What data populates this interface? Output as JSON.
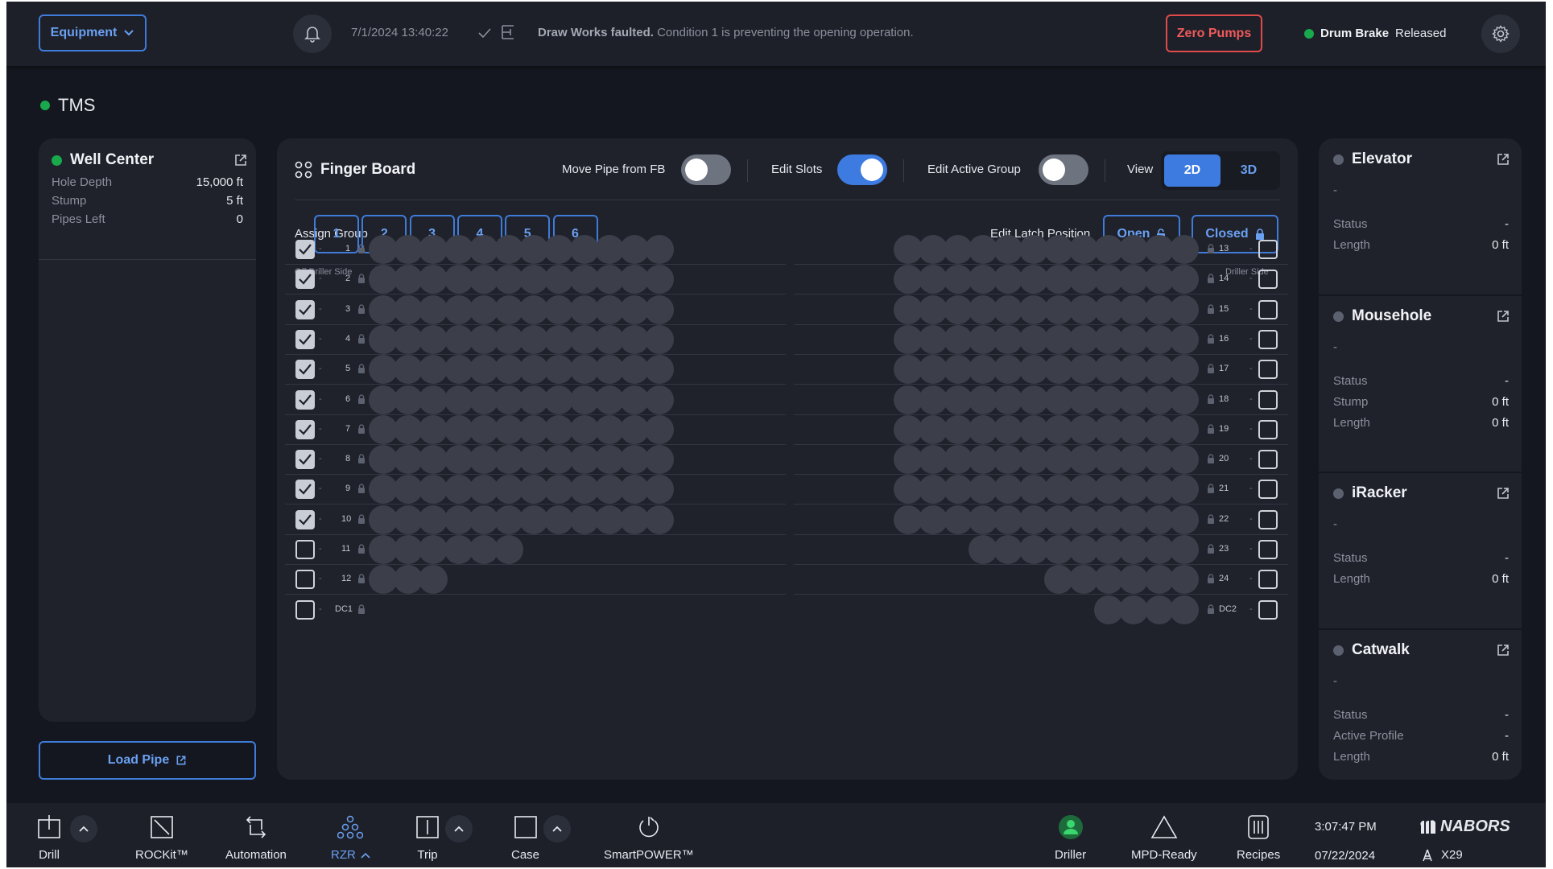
{
  "topbar": {
    "equipment_label": "Equipment",
    "datetime": "7/1/2024  13:40:22",
    "alert_bold": "Draw Works faulted.",
    "alert_text": "Condition 1 is preventing the opening operation.",
    "zero_pumps": "Zero Pumps",
    "drum_brake_label": "Drum Brake",
    "drum_brake_status": "Released"
  },
  "tms": {
    "title": "TMS"
  },
  "well_center": {
    "title": "Well Center",
    "rows": [
      {
        "label": "Hole Depth",
        "value": "15,000 ft"
      },
      {
        "label": "Stump",
        "value": "5 ft"
      },
      {
        "label": "Pipes Left",
        "value": "0"
      }
    ],
    "load_pipe": "Load Pipe"
  },
  "finger_board": {
    "title": "Finger Board",
    "move_pipe_label": "Move Pipe from FB",
    "move_pipe_on": false,
    "edit_slots_label": "Edit Slots",
    "edit_slots_on": true,
    "edit_active_group_label": "Edit Active Group",
    "edit_active_group_on": false,
    "view_label": "View",
    "view_options": [
      "2D",
      "3D"
    ],
    "view_selected": "2D",
    "assign_group_label": "Assign Group",
    "groups": [
      "1",
      "2",
      "3",
      "4",
      "5",
      "6"
    ],
    "edit_latch_label": "Edit Latch Position",
    "latch_open": "Open",
    "latch_closed": "Closed",
    "off_driller_side": "Off Driller Side",
    "driller_side": "Driller Side",
    "dash": "-",
    "left_rows": [
      {
        "label": "1",
        "checked": true,
        "pipes": 12
      },
      {
        "label": "2",
        "checked": true,
        "pipes": 12
      },
      {
        "label": "3",
        "checked": true,
        "pipes": 12
      },
      {
        "label": "4",
        "checked": true,
        "pipes": 12
      },
      {
        "label": "5",
        "checked": true,
        "pipes": 12
      },
      {
        "label": "6",
        "checked": true,
        "pipes": 12
      },
      {
        "label": "7",
        "checked": true,
        "pipes": 12
      },
      {
        "label": "8",
        "checked": true,
        "pipes": 12
      },
      {
        "label": "9",
        "checked": true,
        "pipes": 12
      },
      {
        "label": "10",
        "checked": true,
        "pipes": 12
      },
      {
        "label": "11",
        "checked": false,
        "pipes": 6
      },
      {
        "label": "12",
        "checked": false,
        "pipes": 3
      },
      {
        "label": "DC1",
        "checked": false,
        "pipes": 0
      }
    ],
    "right_rows": [
      {
        "label": "13",
        "checked": false,
        "pipes": 12
      },
      {
        "label": "14",
        "checked": false,
        "pipes": 12
      },
      {
        "label": "15",
        "checked": false,
        "pipes": 12
      },
      {
        "label": "16",
        "checked": false,
        "pipes": 12
      },
      {
        "label": "17",
        "checked": false,
        "pipes": 12
      },
      {
        "label": "18",
        "checked": false,
        "pipes": 12
      },
      {
        "label": "19",
        "checked": false,
        "pipes": 12
      },
      {
        "label": "20",
        "checked": false,
        "pipes": 12
      },
      {
        "label": "21",
        "checked": false,
        "pipes": 12
      },
      {
        "label": "22",
        "checked": false,
        "pipes": 12
      },
      {
        "label": "23",
        "checked": false,
        "pipes": 9
      },
      {
        "label": "24",
        "checked": false,
        "pipes": 6
      },
      {
        "label": "DC2",
        "checked": false,
        "pipes": 4
      }
    ]
  },
  "side_cards": [
    {
      "title": "Elevator",
      "sub": "-",
      "rows": [
        {
          "label": "Status",
          "value": "-"
        },
        {
          "label": "Length",
          "value": "0 ft"
        }
      ]
    },
    {
      "title": "Mousehole",
      "sub": "-",
      "rows": [
        {
          "label": "Status",
          "value": "-"
        },
        {
          "label": "Stump",
          "value": "0 ft"
        },
        {
          "label": "Length",
          "value": "0 ft"
        }
      ]
    },
    {
      "title": "iRacker",
      "sub": "-",
      "rows": [
        {
          "label": "Status",
          "value": "-"
        },
        {
          "label": "Length",
          "value": "0 ft"
        }
      ]
    },
    {
      "title": "Catwalk",
      "sub": "-",
      "rows": [
        {
          "label": "Status",
          "value": "-"
        },
        {
          "label": "Active Profile",
          "value": "-"
        },
        {
          "label": "Length",
          "value": "0 ft"
        }
      ]
    }
  ],
  "bottom_nav": {
    "items": [
      "Drill",
      "ROCKit™",
      "Automation",
      "RZR",
      "Trip",
      "Case",
      "SmartPOWER™",
      "Driller",
      "MPD-Ready",
      "Recipes"
    ],
    "active": "RZR",
    "time": "3:07:47 PM",
    "date": "07/22/2024",
    "brand": "NABORS",
    "rig": "X29"
  },
  "colors": {
    "accent": "#3d7be0",
    "status_green": "#19a84b",
    "alert_red": "#e04a4a",
    "pipe": "#3c3f4a"
  }
}
